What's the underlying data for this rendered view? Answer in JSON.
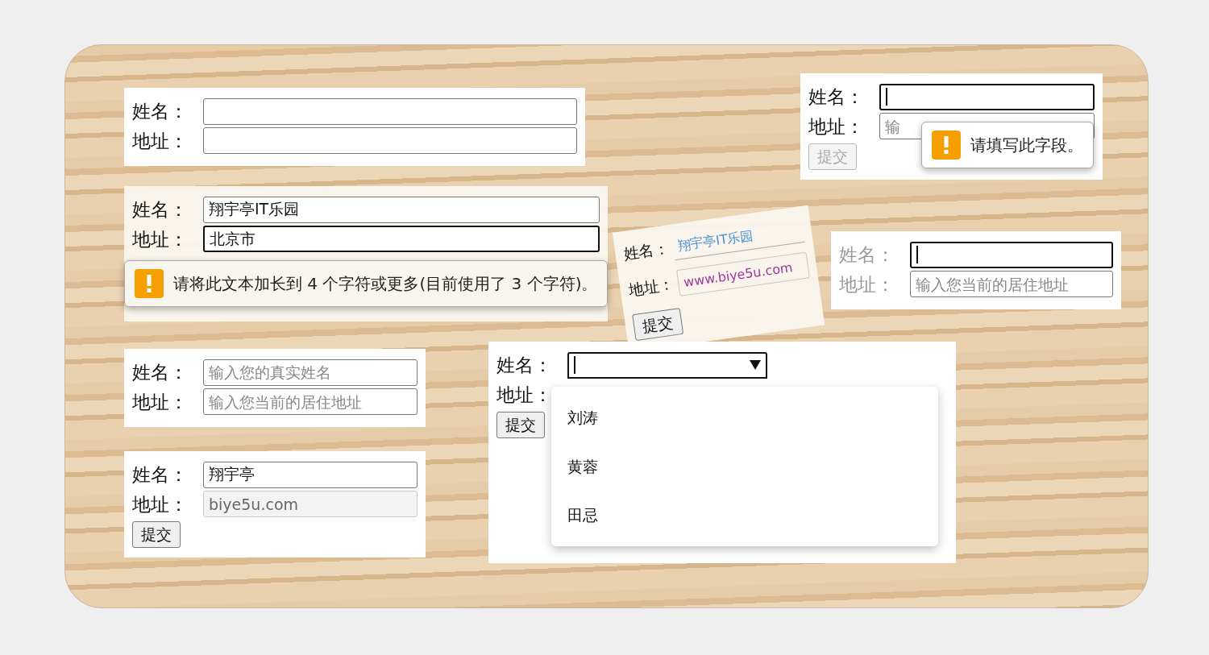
{
  "panels": [
    {
      "kind": "plain",
      "fields": [
        {
          "label": "姓名：",
          "focused": false
        },
        {
          "label": "地址：",
          "focused": false
        }
      ]
    },
    {
      "kind": "validation",
      "fields": [
        {
          "label": "姓名：",
          "value": "翔宇亭IT乐园",
          "focused": false
        },
        {
          "label": "地址：",
          "value": "北京市",
          "focused": true
        }
      ],
      "tooltip": "请将此文本加长到 4 个字符或更多(目前使用了 3 个字符)。"
    },
    {
      "kind": "tilted",
      "fields": [
        {
          "label": "姓名：",
          "value": "翔宇亭IT乐园",
          "focused": false
        },
        {
          "label": "地址：",
          "value": "www.biye5u.com",
          "focused": false
        }
      ],
      "button": {
        "label": "提交",
        "disabled": false
      }
    },
    {
      "kind": "validation",
      "fields": [
        {
          "label": "姓名：",
          "focused": true
        },
        {
          "label": "地址：",
          "placeholder": "输",
          "focused": false
        }
      ],
      "button": {
        "label": "提交",
        "disabled": true
      },
      "tooltip": "请填写此字段。"
    },
    {
      "kind": "plain",
      "muted_labels": true,
      "fields": [
        {
          "label": "姓名：",
          "focused": true
        },
        {
          "label": "地址：",
          "placeholder": "输入您当前的居住地址",
          "focused": false
        }
      ]
    },
    {
      "kind": "plain",
      "fields": [
        {
          "label": "姓名：",
          "placeholder": "输入您的真实姓名",
          "focused": false
        },
        {
          "label": "地址：",
          "placeholder": "输入您当前的居住地址",
          "focused": false
        }
      ]
    },
    {
      "kind": "plain",
      "fields": [
        {
          "label": "姓名：",
          "value": "翔宇亭",
          "focused": false
        },
        {
          "label": "地址：",
          "value": "biye5u.com",
          "focused": false,
          "disabled": true
        }
      ],
      "button": {
        "label": "提交",
        "disabled": false
      }
    },
    {
      "kind": "dropdown",
      "fields": [
        {
          "label": "姓名：",
          "focused": true,
          "expanded": true,
          "options": [
            "刘涛",
            "黄蓉",
            "田忌"
          ]
        },
        {
          "label": "地址："
        }
      ],
      "button": {
        "label": "提交",
        "disabled": false
      }
    }
  ]
}
